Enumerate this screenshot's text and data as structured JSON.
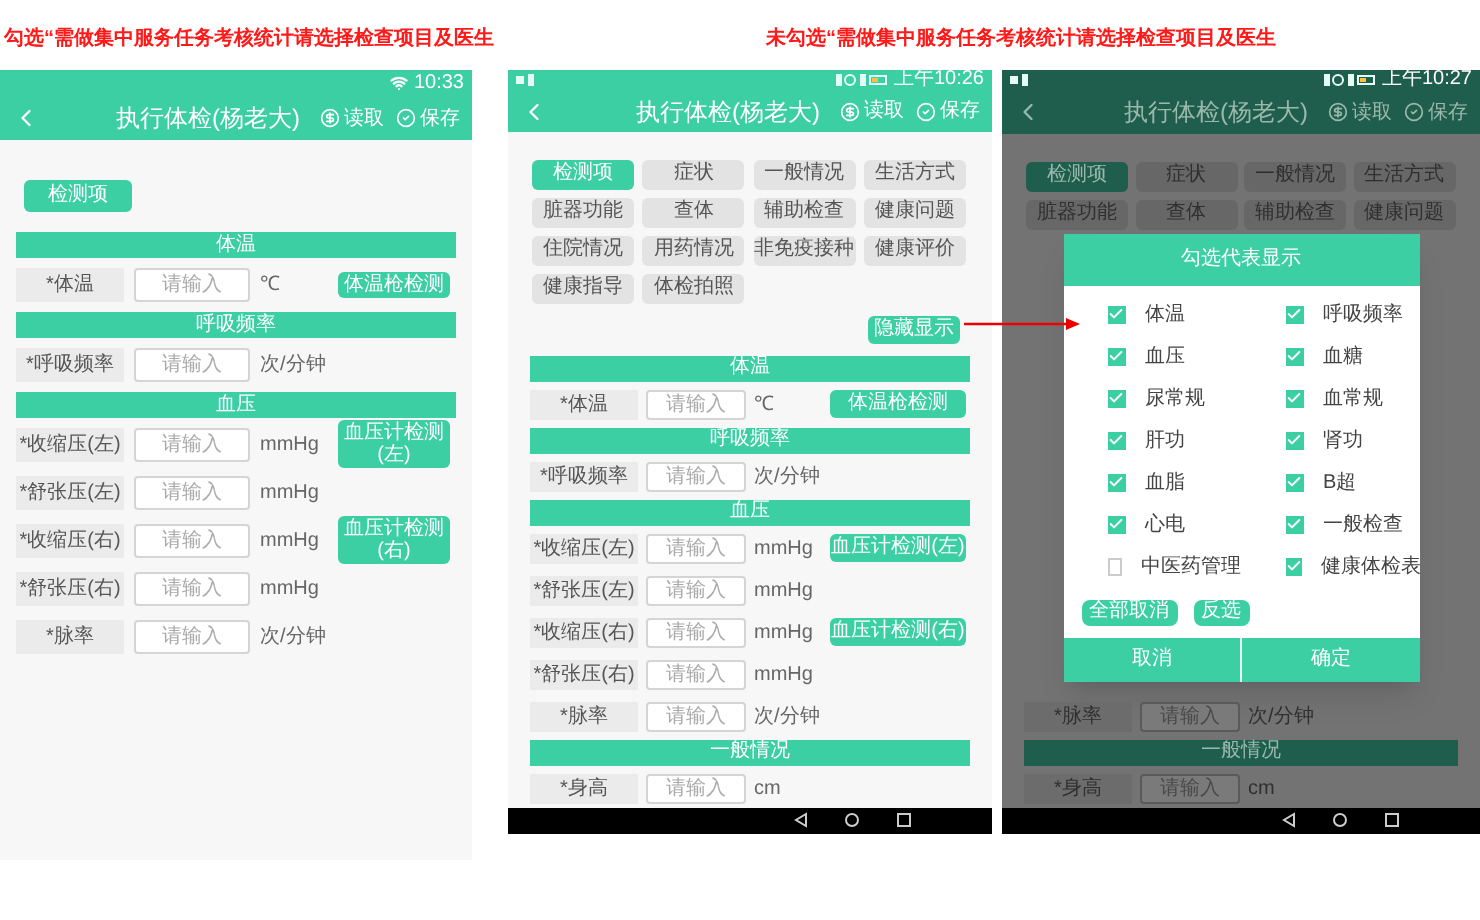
{
  "captions": [
    {
      "text": "勾选“需做集中服务任务考核统计请选择检查项目及医生"
    },
    {
      "text": "未勾选“需做集中服务任务考核统计请选择检查项目及医生"
    }
  ],
  "screens": [
    {
      "kind": "plain",
      "status_bar": {
        "time": "10:33"
      },
      "header": {
        "title": "执行体检(杨老大)",
        "read": "读取",
        "save": "保存"
      },
      "tabs": [
        {
          "label": "检测项",
          "selected": true
        }
      ],
      "sections": [
        {
          "title": "体温",
          "rows": [
            {
              "label": "*体温",
              "placeholder": "请输入",
              "unit": "℃",
              "action": "体温枪检测"
            }
          ]
        },
        {
          "title": "呼吸频率",
          "rows": [
            {
              "label": "*呼吸频率",
              "placeholder": "请输入",
              "unit": "次/分钟"
            }
          ]
        },
        {
          "title": "血压",
          "rows": [
            {
              "label": "*收缩压(左)",
              "placeholder": "请输入",
              "unit": "mmHg",
              "action": "血压计检测(左)"
            },
            {
              "label": "*舒张压(左)",
              "placeholder": "请输入",
              "unit": "mmHg"
            },
            {
              "label": "*收缩压(右)",
              "placeholder": "请输入",
              "unit": "mmHg",
              "action": "血压计检测(右)"
            },
            {
              "label": "*舒张压(右)",
              "placeholder": "请输入",
              "unit": "mmHg"
            },
            {
              "label": "*脉率",
              "placeholder": "请输入",
              "unit": "次/分钟"
            }
          ]
        }
      ]
    },
    {
      "kind": "tabs",
      "status_bar": {
        "time": "上午10:26"
      },
      "header": {
        "title": "执行体检(杨老大)",
        "read": "读取",
        "save": "保存"
      },
      "tabs": [
        {
          "label": "检测项",
          "selected": true
        },
        {
          "label": "症状",
          "selected": false
        },
        {
          "label": "一般情况",
          "selected": false
        },
        {
          "label": "生活方式",
          "selected": false
        },
        {
          "label": "脏器功能",
          "selected": false
        },
        {
          "label": "查体",
          "selected": false
        },
        {
          "label": "辅助检查",
          "selected": false
        },
        {
          "label": "健康问题",
          "selected": false
        },
        {
          "label": "住院情况",
          "selected": false
        },
        {
          "label": "用药情况",
          "selected": false
        },
        {
          "label": "非免疫接种",
          "selected": false
        },
        {
          "label": "健康评价",
          "selected": false
        },
        {
          "label": "健康指导",
          "selected": false
        },
        {
          "label": "体检拍照",
          "selected": false
        }
      ],
      "toggle": "隐藏显示",
      "sections": [
        {
          "title": "体温",
          "rows": [
            {
              "label": "*体温",
              "placeholder": "请输入",
              "unit": "℃",
              "action": "体温枪检测"
            }
          ]
        },
        {
          "title": "呼吸频率",
          "rows": [
            {
              "label": "*呼吸频率",
              "placeholder": "请输入",
              "unit": "次/分钟"
            }
          ]
        },
        {
          "title": "血压",
          "rows": [
            {
              "label": "*收缩压(左)",
              "placeholder": "请输入",
              "unit": "mmHg",
              "action": "血压计检测(左)"
            },
            {
              "label": "*舒张压(左)",
              "placeholder": "请输入",
              "unit": "mmHg"
            },
            {
              "label": "*收缩压(右)",
              "placeholder": "请输入",
              "unit": "mmHg",
              "action": "血压计检测(右)"
            },
            {
              "label": "*舒张压(右)",
              "placeholder": "请输入",
              "unit": "mmHg"
            },
            {
              "label": "*脉率",
              "placeholder": "请输入",
              "unit": "次/分钟"
            }
          ]
        },
        {
          "title": "一般情况",
          "rows": [
            {
              "label": "*身高",
              "placeholder": "请输入",
              "unit": "cm"
            }
          ]
        }
      ],
      "nav_bar": true
    },
    {
      "kind": "dialog",
      "status_bar": {
        "time": "上午10:27"
      },
      "header": {
        "title": "执行体检(杨老大)",
        "read": "读取",
        "save": "保存"
      },
      "tabs": [
        {
          "label": "检测项",
          "selected": true
        },
        {
          "label": "症状",
          "selected": false
        },
        {
          "label": "一般情况",
          "selected": false
        },
        {
          "label": "生活方式",
          "selected": false
        },
        {
          "label": "脏器功能",
          "selected": false
        },
        {
          "label": "查体",
          "selected": false
        },
        {
          "label": "辅助检查",
          "selected": false
        },
        {
          "label": "健康问题",
          "selected": false
        }
      ],
      "dialog": {
        "title": "勾选代表显示",
        "options": [
          {
            "label": "体温",
            "checked": true
          },
          {
            "label": "呼吸频率",
            "checked": true
          },
          {
            "label": "血压",
            "checked": true
          },
          {
            "label": "血糖",
            "checked": true
          },
          {
            "label": "尿常规",
            "checked": true
          },
          {
            "label": "血常规",
            "checked": true
          },
          {
            "label": "肝功",
            "checked": true
          },
          {
            "label": "肾功",
            "checked": true
          },
          {
            "label": "血脂",
            "checked": true
          },
          {
            "label": "B超",
            "checked": true
          },
          {
            "label": "心电",
            "checked": true
          },
          {
            "label": "一般检查",
            "checked": true
          },
          {
            "label": "中医药管理",
            "checked": false
          },
          {
            "label": "健康体检表",
            "checked": true
          }
        ],
        "actions": [
          "全部取消",
          "反选"
        ],
        "footer": [
          "取消",
          "确定"
        ]
      },
      "sections": [
        {
          "rows": [
            {
              "label": "*脉率",
              "placeholder": "请输入",
              "unit": "次/分钟"
            }
          ]
        },
        {
          "title": "一般情况",
          "rows": [
            {
              "label": "*身高",
              "placeholder": "请输入",
              "unit": "cm"
            }
          ]
        }
      ],
      "nav_bar": true
    }
  ]
}
